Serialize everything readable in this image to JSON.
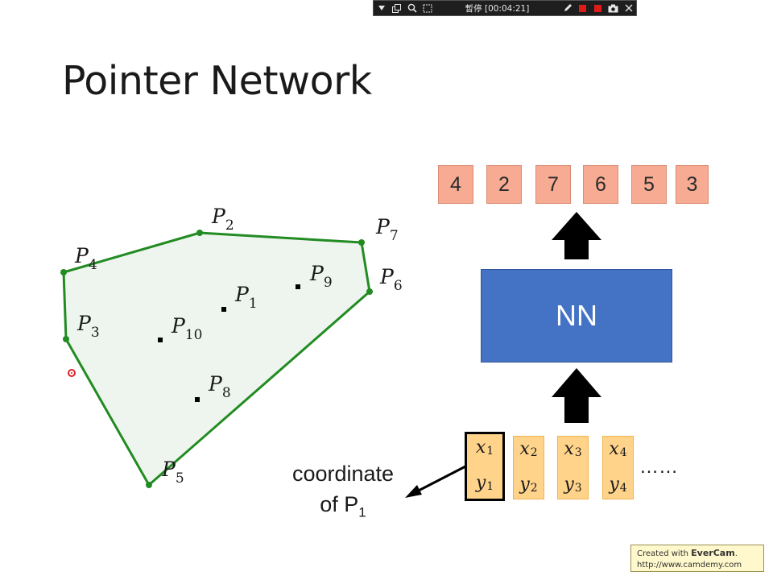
{
  "recorder": {
    "status": "暫停 [00:04:21]",
    "icons": [
      "dropdown-arrow-icon",
      "windows-icon",
      "zoom-icon",
      "region-select-icon",
      "pen-icon",
      "stop-icon",
      "stop-icon",
      "camera-icon",
      "close-icon"
    ],
    "stop_color": "#e01919"
  },
  "slide": {
    "title": "Pointer Network",
    "points": [
      {
        "label": "P",
        "sub": "1",
        "on_hull": false
      },
      {
        "label": "P",
        "sub": "2",
        "on_hull": true
      },
      {
        "label": "P",
        "sub": "3",
        "on_hull": true
      },
      {
        "label": "P",
        "sub": "4",
        "on_hull": true
      },
      {
        "label": "P",
        "sub": "5",
        "on_hull": true
      },
      {
        "label": "P",
        "sub": "6",
        "on_hull": true
      },
      {
        "label": "P",
        "sub": "7",
        "on_hull": true
      },
      {
        "label": "P",
        "sub": "8",
        "on_hull": false
      },
      {
        "label": "P",
        "sub": "9",
        "on_hull": false
      },
      {
        "label": "P",
        "sub": "10",
        "on_hull": false
      }
    ],
    "hull_color": "#228b22",
    "hull_fill": "#eef5ee",
    "outputs": [
      "4",
      "2",
      "7",
      "6",
      "5",
      "3"
    ],
    "nn_label": "NN",
    "inputs": [
      {
        "x": "x",
        "y": "y",
        "sub": "1"
      },
      {
        "x": "x",
        "y": "y",
        "sub": "2"
      },
      {
        "x": "x",
        "y": "y",
        "sub": "3"
      },
      {
        "x": "x",
        "y": "y",
        "sub": "4"
      }
    ],
    "ellipsis": "……",
    "caption_line1": "coordinate",
    "caption_line2": "of P",
    "caption_sub": "1",
    "colors": {
      "output": "#f6ab92",
      "nn": "#4472c4",
      "input": "#ffd38a"
    }
  },
  "watermark": {
    "line1_prefix": "Created with ",
    "brand": "EverCam",
    "line1_suffix": ".",
    "line2": "http://www.camdemy.com"
  }
}
